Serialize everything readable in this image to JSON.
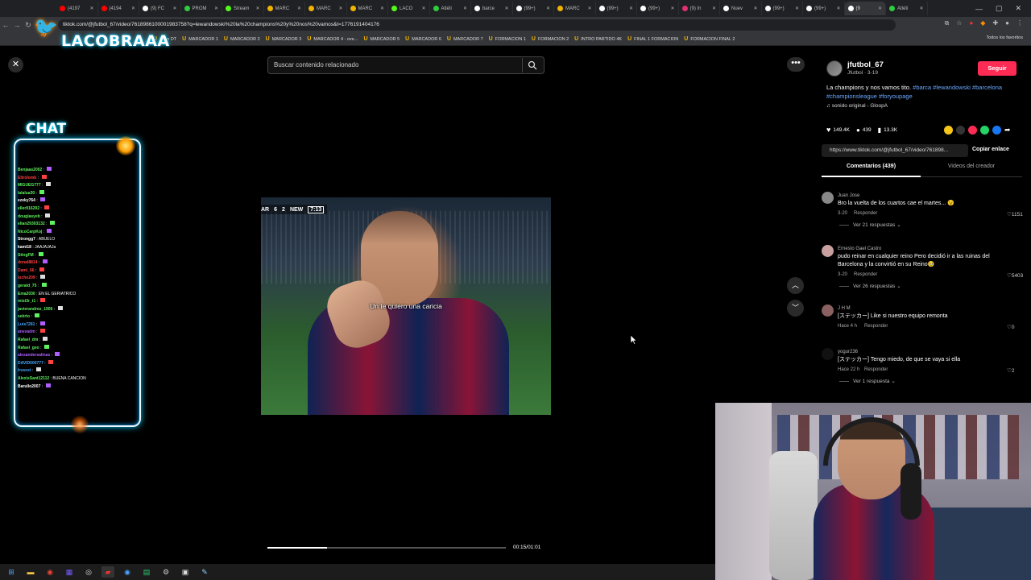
{
  "browser": {
    "tabs": [
      {
        "label": "(4197",
        "color": "#ff0000"
      },
      {
        "label": "(4194",
        "color": "#ff0000"
      },
      {
        "label": "(9) FC",
        "color": "#ffffff"
      },
      {
        "label": "PROM",
        "color": "#2ecc40"
      },
      {
        "label": "Stream",
        "color": "#53fc18"
      },
      {
        "label": "MARC",
        "color": "#f0b400"
      },
      {
        "label": "MARC",
        "color": "#f0b400"
      },
      {
        "label": "MARC",
        "color": "#f0b400"
      },
      {
        "label": "LACO",
        "color": "#53fc18"
      },
      {
        "label": "Atléti",
        "color": "#2ecc40"
      },
      {
        "label": "barce",
        "color": "#ffffff"
      },
      {
        "label": "(99+)",
        "color": "#ffffff"
      },
      {
        "label": "MARC",
        "color": "#f0b400"
      },
      {
        "label": "(99+)",
        "color": "#ffffff"
      },
      {
        "label": "(99+)",
        "color": "#ffffff"
      },
      {
        "label": "(9) In",
        "color": "#e1306c"
      },
      {
        "label": "Nuev",
        "color": "#ffffff"
      },
      {
        "label": "(99+)",
        "color": "#ffffff"
      },
      {
        "label": "(99+)",
        "color": "#ffffff"
      },
      {
        "label": "(9",
        "color": "#ffffff"
      },
      {
        "label": "Atléti",
        "color": "#2ecc40"
      }
    ],
    "url": "tiktok.com/@jfutbol_67/video/7618986100001983758?q=lewandowski%20la%20champions%20y%20nos%20vamos&t=1776191404176",
    "bookmarks": [
      "Gran DT",
      "MARCADOR 1",
      "MARCADOR 2",
      "MARCADOR 3",
      "MARCADOR 4 - ove...",
      "MARCADOR 5",
      "MARCADOR 6",
      "MARCADOR 7",
      "FORMACION 1",
      "FORMACION 2",
      "INTRO PARTIDO 4K",
      "FINAL 1 FORMACION",
      "FORMACION FINAL 2"
    ],
    "bookmarks_right": "Todos los favoritos"
  },
  "overlay": {
    "logo": "LACOBRAAA",
    "chat_title": "CHAT",
    "chat": [
      {
        "user": "Benjaas2002",
        "msg": "",
        "color": "#5ef25e"
      },
      {
        "user": "Eltrolomb",
        "msg": "",
        "color": "#ff4040"
      },
      {
        "user": "MIGUEG777",
        "msg": "",
        "color": "#5ef25e"
      },
      {
        "user": "lalalua30",
        "msg": "",
        "color": "#5ef25e"
      },
      {
        "user": "ezeky764",
        "msg": "",
        "color": "#ffffff"
      },
      {
        "user": "eller916292",
        "msg": "",
        "color": "#5ef25e"
      },
      {
        "user": "douglasyeb",
        "msg": "",
        "color": "#5ef25e"
      },
      {
        "user": "elian29303132",
        "msg": "",
        "color": "#5ef25e"
      },
      {
        "user": "NicoCarpKoj",
        "msg": "",
        "color": "#5ef25e"
      },
      {
        "user": "Strongg7",
        "msg": "ABUELO",
        "color": "#ffffff"
      },
      {
        "user": "kami18",
        "msg": "JAAJAJAJa",
        "color": "#ffffff"
      },
      {
        "user": "StingFM",
        "msg": "",
        "color": "#5ef25e"
      },
      {
        "user": "donal8814",
        "msg": "",
        "color": "#ff4040"
      },
      {
        "user": "Dami_66",
        "msg": "",
        "color": "#ff4040"
      },
      {
        "user": "lucho209",
        "msg": "",
        "color": "#ff4040"
      },
      {
        "user": "gerald_75",
        "msg": "",
        "color": "#5ef25e"
      },
      {
        "user": "Ema2030",
        "msg": "EN EL GERIATRICO",
        "color": "#5ef25e"
      },
      {
        "user": "mist3r_t1",
        "msg": "",
        "color": "#5ef25e"
      },
      {
        "user": "javierandres_1906",
        "msg": "",
        "color": "#5ef25e"
      },
      {
        "user": "sekrto",
        "msg": "",
        "color": "#5ef25e"
      },
      {
        "user": "Luis7281",
        "msg": "",
        "color": "#3fa7ff"
      },
      {
        "user": "anexadm",
        "msg": "",
        "color": "#b05eff"
      },
      {
        "user": "Rafael_dm",
        "msg": "",
        "color": "#5ef25e"
      },
      {
        "user": "Rafael_geo",
        "msg": "",
        "color": "#5ef25e"
      },
      {
        "user": "alexandersalinas",
        "msg": "",
        "color": "#b05eff"
      },
      {
        "user": "DAVID000777",
        "msg": "",
        "color": "#3fa7ff"
      },
      {
        "user": "Irusest",
        "msg": "",
        "color": "#3fa7ff"
      },
      {
        "user": "AlexisSant12112",
        "msg": "BUENA CANCION",
        "color": "#5ef25e"
      },
      {
        "user": "Barullo2007",
        "msg": "",
        "color": "#ffffff"
      }
    ]
  },
  "search": {
    "placeholder": "Buscar contenido relacionado"
  },
  "video": {
    "score_bug": [
      "AR",
      "6",
      "2",
      "NEW"
    ],
    "clock": "7:13",
    "subtitle": "Un te quiero una caricia",
    "time": "00:15/01:01",
    "progress": 0.25
  },
  "creator": {
    "name": "jfutbol_67",
    "sub": "Jfutbol · 3-19",
    "follow": "Seguir",
    "caption_text": "La champions y nos vamos tito.",
    "caption_tags": "#barca #lewandowski #barcelona #championsleague #foryoupage",
    "sound": "sonido original - GloopA"
  },
  "stats": {
    "likes": "149.4K",
    "comments": "439",
    "saves": "13.3K"
  },
  "link": {
    "url": "https://www.tiktok.com/@jfutbol_67/video/761898...",
    "copy": "Copiar enlace"
  },
  "tabs": {
    "comments": "Comentarios (439)",
    "videos": "Videos del creador"
  },
  "comments": [
    {
      "user": "Juan Jose",
      "text": "Bro la vuelta de los cuartos cae el martes... 😉",
      "date": "3-20",
      "reply": "Responder",
      "likes": "1151",
      "replies": "Ver 21 respuestas",
      "color": "#888"
    },
    {
      "user": "Ernesto Gael Castro",
      "text": "pudo reinar en cualquier reino Pero decidió ir a las ruinas del Barcelona y la convirtió en su Reino🥹",
      "date": "3-20",
      "reply": "Responder",
      "likes": "5403",
      "replies": "Ver 26 respuestas",
      "color": "#c9a0a0"
    },
    {
      "user": "J H M",
      "text": "[ステッカー] Like si nuestro equipo remonta",
      "date": "Hace 4 h",
      "reply": "Responder",
      "likes": "0",
      "replies": "",
      "color": "#8a6060"
    },
    {
      "user": "yogur236",
      "text": "[ステッカー] Tengo miedo, de que se vaya si ella",
      "date": "Hace 22 h",
      "reply": "Responder",
      "likes": "2",
      "replies": "Ver 1 respuesta",
      "color": "#111"
    }
  ],
  "window": {
    "minimize": "—",
    "maximize": "▢",
    "close": "✕"
  }
}
